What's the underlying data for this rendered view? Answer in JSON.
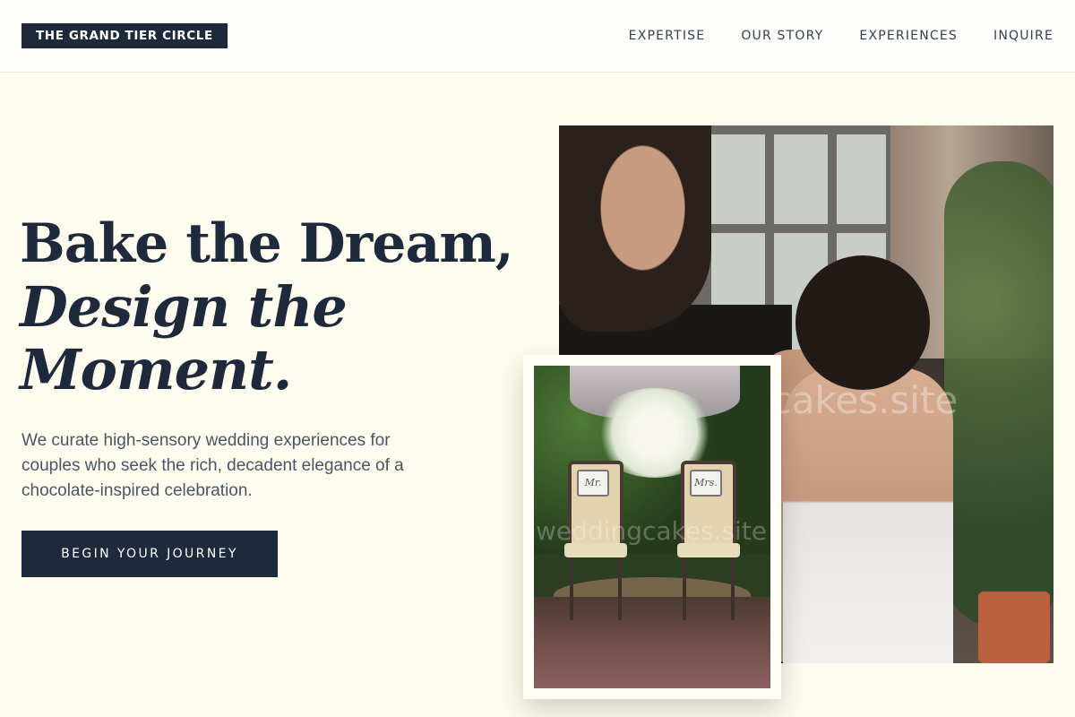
{
  "header": {
    "logo_text": "THE GRAND TIER CIRCLE",
    "nav": [
      {
        "label": "EXPERTISE"
      },
      {
        "label": "OUR STORY"
      },
      {
        "label": "EXPERIENCES"
      },
      {
        "label": "INQUIRE"
      }
    ]
  },
  "hero": {
    "headline_line1": "Bake the Dream,",
    "headline_line2": "Design the",
    "headline_line3": "Moment.",
    "subtext": "We curate high-sensory wedding experiences for couples who seek the rich, decadent elegance of a chocolate-inspired celebration.",
    "cta_label": "BEGIN YOUR JOURNEY"
  },
  "images": {
    "main_alt": "Groom adjusting bride's hair",
    "small_alt": "Mr. and Mrs. chairs under floral arch",
    "chair_left_sign": "Mr.",
    "chair_right_sign": "Mrs.",
    "watermark": "weddingcakes.site",
    "watermark_partial": "gcakes.site"
  },
  "colors": {
    "primary": "#1e293b",
    "background": "#fefbef",
    "text_muted": "#4b5563"
  }
}
